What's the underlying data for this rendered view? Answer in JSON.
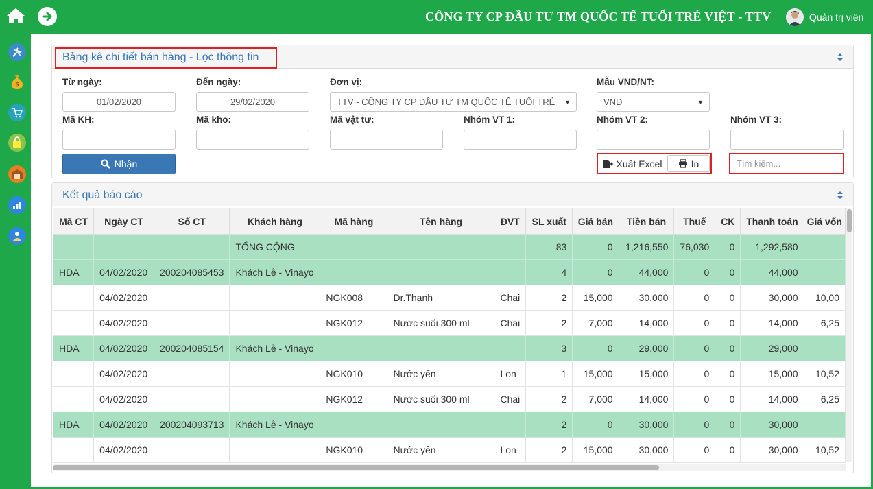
{
  "header": {
    "company": "CÔNG TY CP ĐẦU TƯ TM QUỐC TẾ TUỔI TRẺ VIỆT - TTV",
    "user": "Quản trị viên"
  },
  "sidebar": {
    "items": [
      "tools-icon",
      "money-bag-icon",
      "cart-icon",
      "shopping-bag-icon",
      "warehouse-icon",
      "report-chart-icon",
      "user-icon"
    ]
  },
  "filter": {
    "title": "Bảng kê chi tiết bán hàng - Lọc thông tin",
    "from_date_label": "Từ ngày:",
    "from_date": "01/02/2020",
    "to_date_label": "Đến ngày:",
    "to_date": "29/02/2020",
    "unit_label": "Đơn vị:",
    "unit_value": "TTV - CÔNG TY CP ĐẦU TƯ TM QUỐC TẾ TUỔI TRẺ",
    "currency_label": "Mẫu VND/NT:",
    "currency_value": "VNĐ",
    "customer_label": "Mã KH:",
    "warehouse_label": "Mã kho:",
    "material_label": "Mã vật tư:",
    "group1_label": "Nhóm VT 1:",
    "group2_label": "Nhóm VT 2:",
    "group3_label": "Nhóm VT 3:",
    "submit": "Nhận",
    "export_excel": "Xuất Excel",
    "print": "In",
    "search_placeholder": "Tìm kiếm..."
  },
  "results": {
    "title": "Kết quả báo cáo",
    "columns": [
      "Mã CT",
      "Ngày CT",
      "Số CT",
      "Khách hàng",
      "Mã hàng",
      "Tên hàng",
      "ĐVT",
      "SL xuất",
      "Giá bán",
      "Tiền bán",
      "Thuế",
      "CK",
      "Thanh toán",
      "Giá vốn"
    ],
    "rows": [
      {
        "group": true,
        "cells": [
          "",
          "",
          "",
          "TỔNG CỘNG",
          "",
          "",
          "",
          "83",
          "0",
          "1,216,550",
          "76,030",
          "0",
          "1,292,580",
          ""
        ]
      },
      {
        "group": true,
        "cells": [
          "HDA",
          "04/02/2020",
          "200204085453",
          "Khách Lẻ - Vinayo",
          "",
          "",
          "",
          "4",
          "0",
          "44,000",
          "0",
          "0",
          "44,000",
          ""
        ]
      },
      {
        "group": false,
        "cells": [
          "",
          "04/02/2020",
          "",
          "",
          "NGK008",
          "Dr.Thanh",
          "Chai",
          "2",
          "15,000",
          "30,000",
          "0",
          "0",
          "30,000",
          "10,00"
        ]
      },
      {
        "group": false,
        "cells": [
          "",
          "04/02/2020",
          "",
          "",
          "NGK012",
          "Nước suối 300 ml",
          "Chai",
          "2",
          "7,000",
          "14,000",
          "0",
          "0",
          "14,000",
          "6,25"
        ]
      },
      {
        "group": true,
        "cells": [
          "HDA",
          "04/02/2020",
          "200204085154",
          "Khách Lẻ - Vinayo",
          "",
          "",
          "",
          "3",
          "0",
          "29,000",
          "0",
          "0",
          "29,000",
          ""
        ]
      },
      {
        "group": false,
        "cells": [
          "",
          "04/02/2020",
          "",
          "",
          "NGK010",
          "Nước yến",
          "Lon",
          "1",
          "15,000",
          "15,000",
          "0",
          "0",
          "15,000",
          "10,52"
        ]
      },
      {
        "group": false,
        "cells": [
          "",
          "04/02/2020",
          "",
          "",
          "NGK012",
          "Nước suối 300 ml",
          "Chai",
          "2",
          "7,000",
          "14,000",
          "0",
          "0",
          "14,000",
          "6,25"
        ]
      },
      {
        "group": true,
        "cells": [
          "HDA",
          "04/02/2020",
          "200204093713",
          "Khách Lẻ - Vinayo",
          "",
          "",
          "",
          "2",
          "0",
          "30,000",
          "0",
          "0",
          "30,000",
          ""
        ]
      },
      {
        "group": false,
        "cells": [
          "",
          "04/02/2020",
          "",
          "",
          "NGK010",
          "Nước yến",
          "Lon",
          "2",
          "15,000",
          "30,000",
          "0",
          "0",
          "30,000",
          "10,52"
        ]
      }
    ]
  },
  "colors": {
    "brand_green": "#1fa84a",
    "group_row": "#a8e0c1",
    "primary_blue": "#3a78b5",
    "highlight_red": "#e02020"
  }
}
